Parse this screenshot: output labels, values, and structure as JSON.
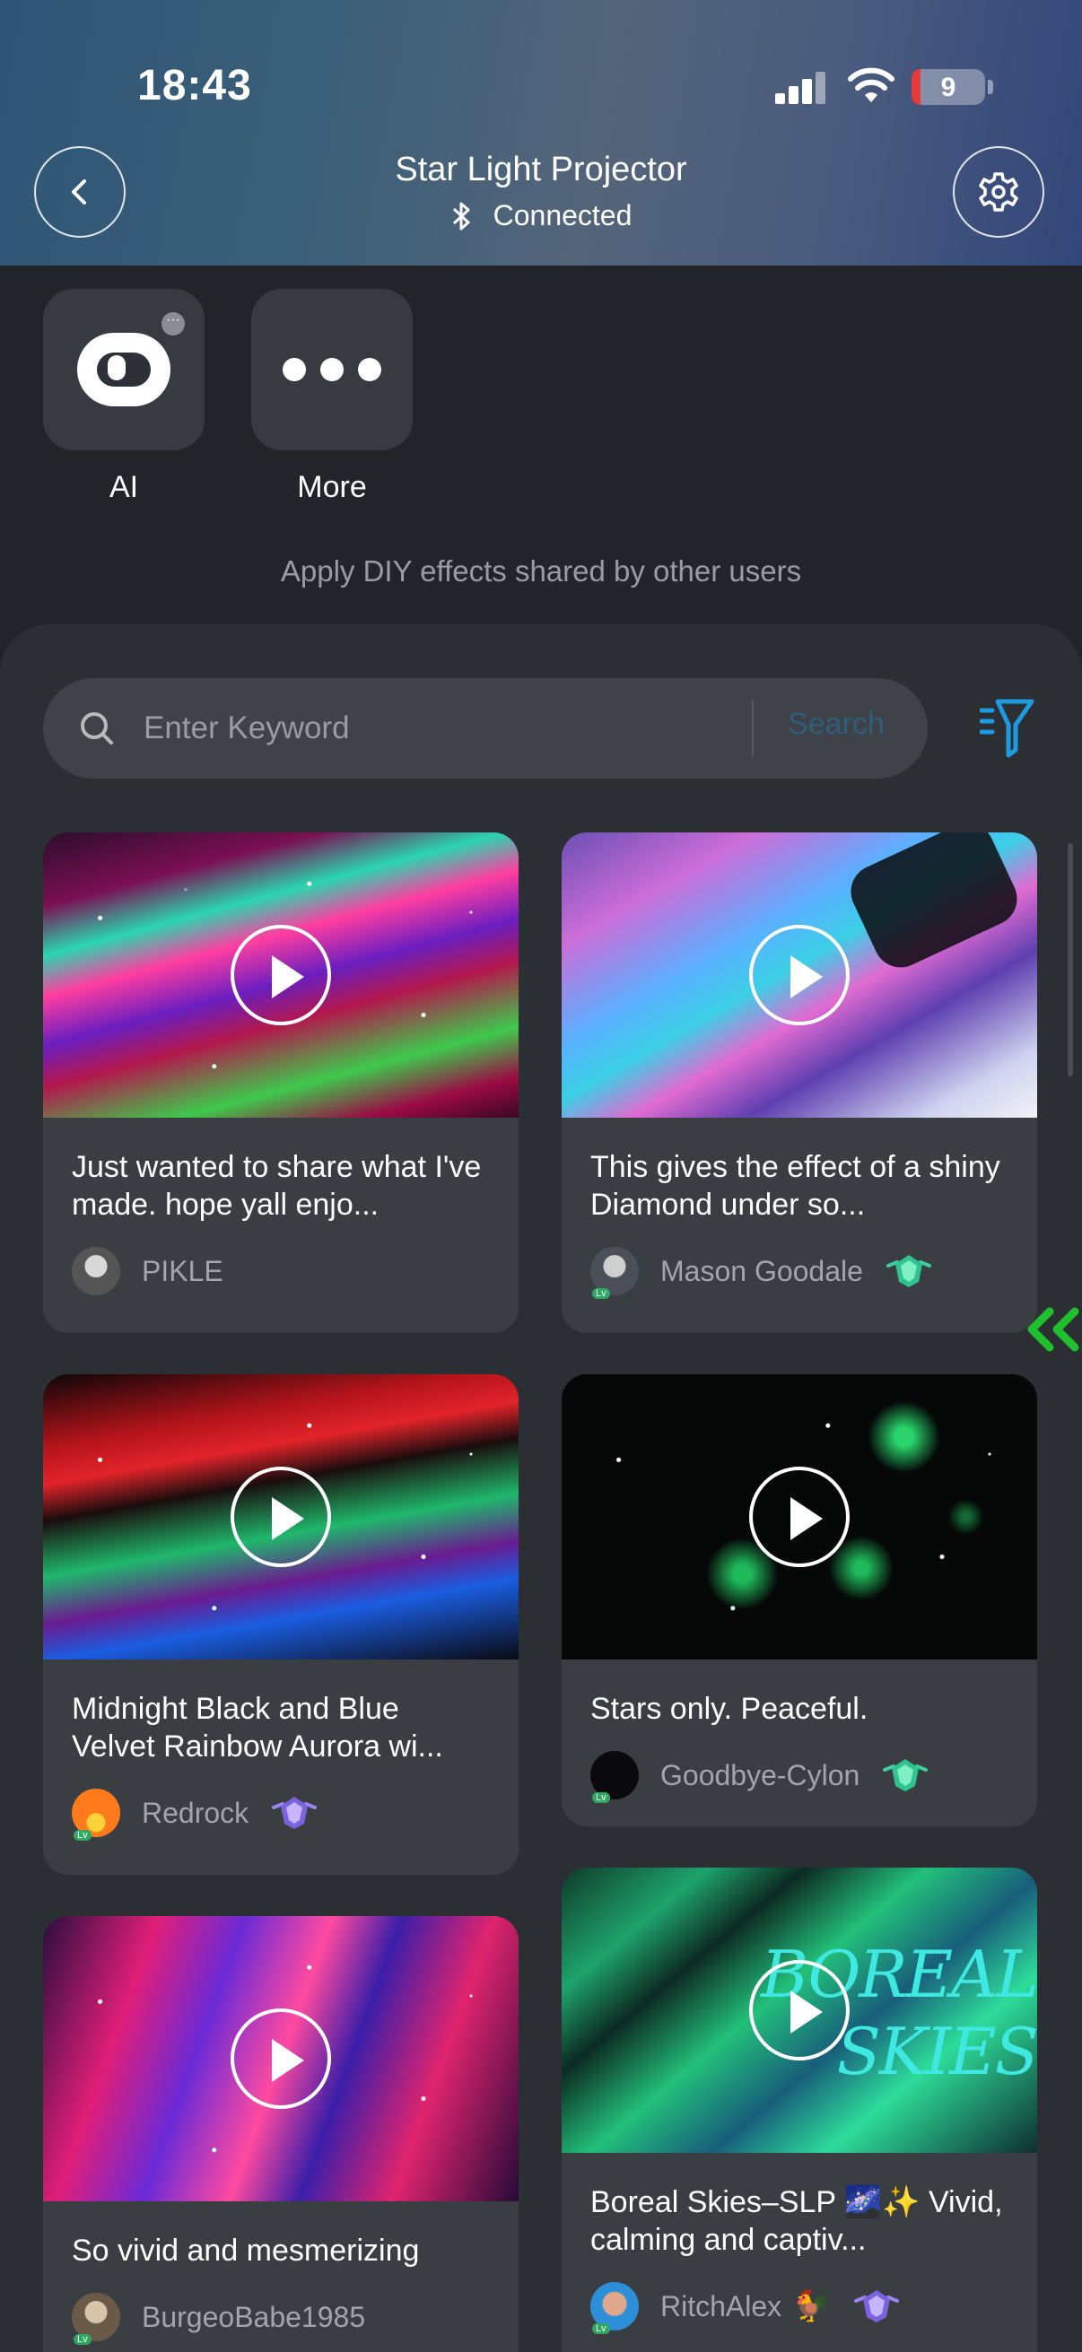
{
  "status_bar": {
    "time": "18:43",
    "battery_level": "9"
  },
  "header": {
    "title": "Star Light Projector",
    "connection_status": "Connected"
  },
  "tiles": [
    {
      "label": "AI",
      "icon": "robot-face-icon"
    },
    {
      "label": "More",
      "icon": "more-dots-icon"
    }
  ],
  "hint": "Apply DIY effects shared by other users",
  "search": {
    "placeholder": "Enter Keyword",
    "button_label": "Search"
  },
  "cards": [
    {
      "title": "Just wanted to share what I've made. hope yall enjo...",
      "author": "PIKLE",
      "badge": null
    },
    {
      "title": "This gives the effect of a shiny Diamond under so...",
      "author": "Mason Goodale",
      "badge": "green-gem"
    },
    {
      "title": "Midnight Black and Blue Velvet Rainbow Aurora wi...",
      "author": "Redrock",
      "badge": "purple-gem"
    },
    {
      "title": "Stars only.  Peaceful.",
      "author": "Goodbye-Cylon",
      "badge": "green-gem"
    },
    {
      "title": "So vivid and mesmerizing",
      "author": "BurgeoBabe1985",
      "badge": null
    },
    {
      "title": "Boreal Skies–SLP 🌌✨ Vivid, calming and captiv...",
      "author": "RitchAlex",
      "author_emoji": "🐓",
      "badge": "purple-gem",
      "thumb_text": [
        "BOREAL",
        "SKIES"
      ]
    }
  ],
  "colors": {
    "accent_blue": "#1e9be0",
    "collapse_arrow": "#1fbf2d",
    "search_btn": "#2f5e79"
  }
}
